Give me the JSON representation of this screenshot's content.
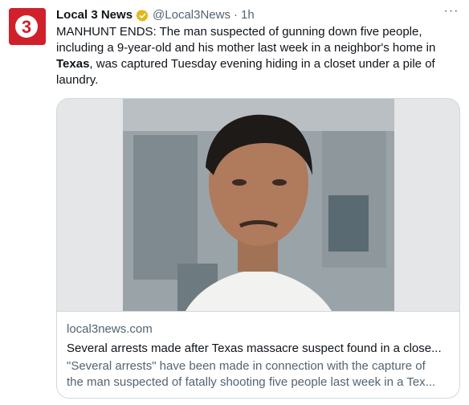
{
  "author": {
    "display_name": "Local 3 News",
    "handle": "@Local3News",
    "separator": "·",
    "timestamp": "1h",
    "verified": true,
    "badge_color": "#e2b719",
    "avatar_text": "3",
    "avatar_color": "#d0202b"
  },
  "tweet": {
    "text_before": "MANHUNT ENDS: The man suspected of gunning down five people, including a 9-year-old and his mother last week in a neighbor's home in ",
    "text_bold": "Texas",
    "text_after": ", was captured Tuesday evening hiding in a closet under a pile of laundry."
  },
  "menu": {
    "more_icon": "more-horizontal-icon",
    "more_label": "···"
  },
  "card": {
    "image_alt": "photo of suspect",
    "domain": "local3news.com",
    "title": "Several arrests made after Texas massacre suspect found in a close...",
    "description_line1": "\"Several arrests\" have been made in connection with the capture of",
    "description_line2": "the man suspected of fatally shooting five people last week in a Tex..."
  }
}
